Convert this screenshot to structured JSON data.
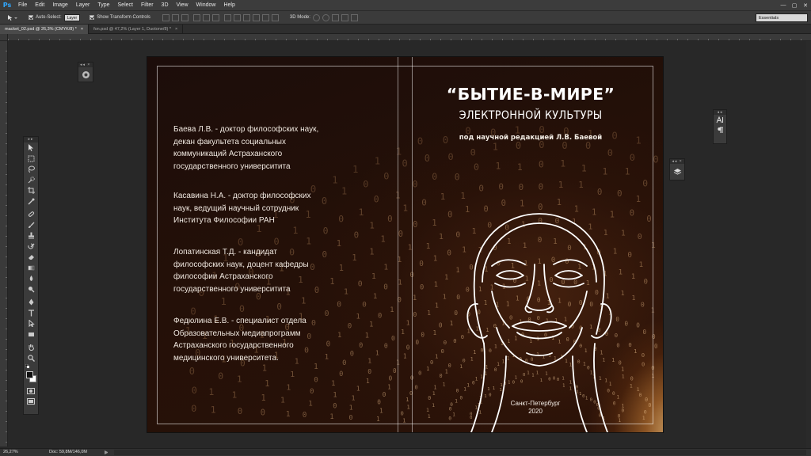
{
  "app": {
    "logo": "Ps"
  },
  "menu": [
    "File",
    "Edit",
    "Image",
    "Layer",
    "Type",
    "Select",
    "Filter",
    "3D",
    "View",
    "Window",
    "Help"
  ],
  "window_controls": {
    "minimize": "—",
    "maximize": "▢",
    "close": "✕"
  },
  "options_bar": {
    "auto_select_label": "Auto-Select:",
    "auto_select_value": "Layer",
    "transform_label": "Show Transform Controls",
    "mode_label": "3D Mode:",
    "workspace": "Essentials"
  },
  "tabs": [
    {
      "label": "macket_02.psd @ 26,3% (CMYK/8) *",
      "close": "×"
    },
    {
      "label": "fon.psd @ 47,2% (Layer 1, Duotone/8) *",
      "close": "×"
    }
  ],
  "document": {
    "title": "“БЫТИЕ-В-МИРЕ”",
    "subtitle": "ЭЛЕКТРОННОЙ КУЛЬТУРЫ",
    "editor": "под научной редакцией Л.В. Баевой",
    "authors": [
      "Баева Л.В. - доктор философских наук,\nдекан факультета социальных\nкоммуникаций Астраханского\nгосударственного университита",
      "Касавина Н.А. - доктор философских\nнаук, ведущий научный сотрудник\nИнститута Философии РАН",
      "Лопатинская Т.Д. - кандидат\nфилософских наук, доцент кафедры\nфилософии Астраханского\nгосударственного университита",
      "Федюлина Е.В. - специалист отдела\nОбразовательных медиапрограмм\nАстраханского государственного\nмедицинского университета."
    ],
    "city": "Санкт-Петербург",
    "year": "2020"
  },
  "status": {
    "zoom": "26,27%",
    "doc": "Doc: 59,8M/146,0M"
  },
  "colors": {
    "accent": "#31a8ff",
    "glow": "#f0b060",
    "cover_bg": "#241008"
  },
  "icons": {
    "tools": [
      "move-icon",
      "marquee-icon",
      "lasso-icon",
      "quick-select-icon",
      "crop-icon",
      "eyedropper-icon",
      "healing-icon",
      "brush-icon",
      "clone-stamp-icon",
      "history-brush-icon",
      "eraser-icon",
      "gradient-icon",
      "blur-icon",
      "dodge-icon",
      "pen-icon",
      "type-icon",
      "path-select-icon",
      "rectangle-icon",
      "hand-icon",
      "zoom-icon"
    ]
  }
}
